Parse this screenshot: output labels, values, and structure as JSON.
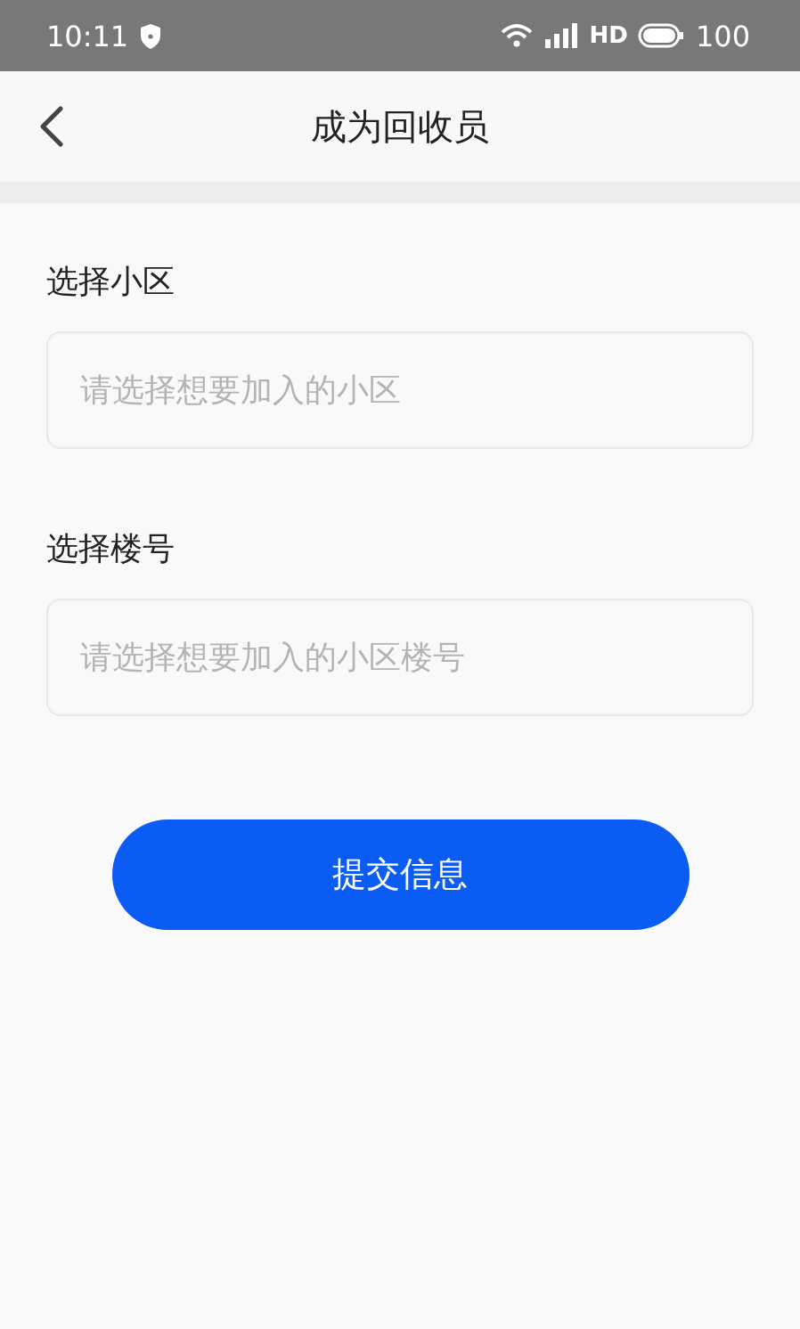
{
  "status_bar": {
    "time": "10:11",
    "network": "HD",
    "battery": "100"
  },
  "header": {
    "title": "成为回收员"
  },
  "form": {
    "fields": [
      {
        "label": "选择小区",
        "placeholder": "请选择想要加入的小区"
      },
      {
        "label": "选择楼号",
        "placeholder": "请选择想要加入的小区楼号"
      }
    ],
    "submit": "提交信息"
  }
}
